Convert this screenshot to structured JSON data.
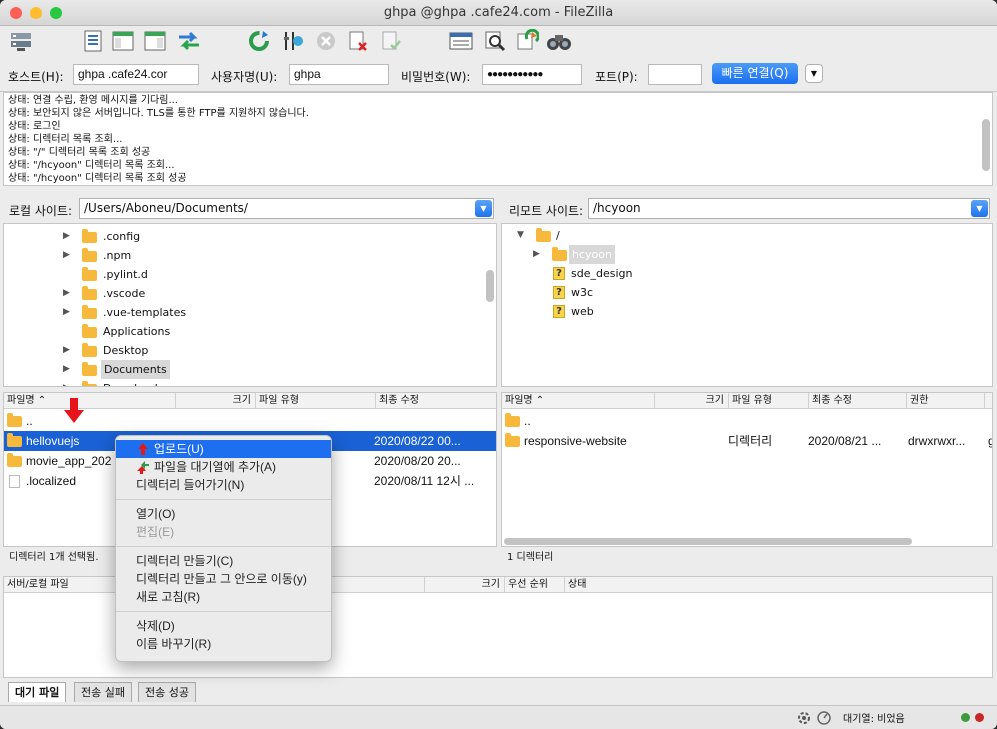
{
  "window": {
    "title": "ghpa        @ghpa        .cafe24.com - FileZilla"
  },
  "toolbar": {
    "icons": [
      "site-manager-icon",
      "message-log-icon",
      "local-tree-icon",
      "remote-tree-icon",
      "transfer-queue-icon",
      "refresh-icon",
      "process-queue-icon",
      "cancel-icon",
      "disconnect-icon",
      "reconnect-icon",
      "filter-icon",
      "compare-icon",
      "sync-browse-icon",
      "search-icon"
    ]
  },
  "quickconnect": {
    "host_label": "호스트(H):",
    "host_value": "ghpa      .cafe24.cor",
    "user_label": "사용자명(U):",
    "user_value": "ghpa",
    "pass_label": "비밀번호(W):",
    "pass_value": "●●●●●●●●●●●",
    "port_label": "포트(P):",
    "port_value": "",
    "connect_label": "빠른 연결(Q)",
    "dropdown_glyph": "▼"
  },
  "log": [
    "상태:  연결 수립, 환영 메시지를 기다림...",
    "상태:  보안되지 않은 서버입니다. TLS를 통한 FTP를 지원하지 않습니다.",
    "상태:  로그인",
    "상태:  디렉터리 목록 조회...",
    "상태:  \"/\" 디렉터리 목록 조회 성공",
    "상태:  \"/hcyoon\" 디렉터리 목록 조회...",
    "상태:  \"/hcyoon\" 디렉터리 목록 조회 성공"
  ],
  "local": {
    "site_label": "로컬 사이트:",
    "path": "/Users/Aboneu/Documents/",
    "tree": [
      {
        "name": ".config",
        "expander": "▶"
      },
      {
        "name": ".npm",
        "expander": "▶"
      },
      {
        "name": ".pylint.d",
        "expander": ""
      },
      {
        "name": ".vscode",
        "expander": "▶"
      },
      {
        "name": ".vue-templates",
        "expander": "▶"
      },
      {
        "name": "Applications",
        "expander": ""
      },
      {
        "name": "Desktop",
        "expander": "▶"
      },
      {
        "name": "Documents",
        "expander": "▶"
      },
      {
        "name": "Downloads",
        "expander": "▶"
      }
    ],
    "headers": {
      "name": "파일명",
      "size": "크기",
      "type": "파일 유형",
      "modified": "최종 수정"
    },
    "files": [
      {
        "name": "..",
        "modified": ""
      },
      {
        "name": "hellovuejs",
        "modified": "2020/08/22 00..."
      },
      {
        "name": "movie_app_202",
        "modified": "2020/08/20 20..."
      },
      {
        "name": ".localized",
        "modified": "2020/08/11 12시 ..."
      }
    ],
    "status": "디렉터리 1개 선택됨."
  },
  "remote": {
    "site_label": "리모트 사이트:",
    "path": "/hcyoon",
    "tree": [
      {
        "name": "/",
        "expander": "▼"
      },
      {
        "name": "hcyoon",
        "expander": "▶"
      },
      {
        "name": "sde_design",
        "expander": ""
      },
      {
        "name": "w3c",
        "expander": ""
      },
      {
        "name": "web",
        "expander": ""
      }
    ],
    "unknown_glyph": "?",
    "headers": {
      "name": "파일명",
      "size": "크기",
      "type": "파일 유형",
      "modified": "최종 수정",
      "perm": "권한",
      "extra": ""
    },
    "files": [
      {
        "name": "..",
        "type": "",
        "modified": "",
        "perm": "",
        "extra": ""
      },
      {
        "name": "responsive-website",
        "type": "디렉터리",
        "modified": "2020/08/21 ...",
        "perm": "drwxrwxr...",
        "extra": "g"
      }
    ],
    "status": "1 디렉터리"
  },
  "queue": {
    "headers": {
      "file": "서버/로컬 파일",
      "size": "크기",
      "priority": "우선 순위",
      "state": "상태"
    }
  },
  "tabs": [
    "대기 파일",
    "전송 실패",
    "전송 성공"
  ],
  "footer": {
    "queue_status": "대기열: 비었음"
  },
  "context_menu": {
    "items": [
      {
        "label": "업로드(U)",
        "state": "highlighted",
        "icon": "upload-arrow-icon"
      },
      {
        "label": "파일을 대기열에 추가(A)",
        "state": "normal",
        "icon": "add-queue-icon"
      },
      {
        "label": "디렉터리 들어가기(N)",
        "state": "normal"
      },
      {
        "label": "열기(O)",
        "state": "normal"
      },
      {
        "label": "편집(E)",
        "state": "disabled"
      },
      {
        "label": "디렉터리 만들기(C)",
        "state": "normal"
      },
      {
        "label": "디렉터리 만들고 그 안으로 이동(y)",
        "state": "normal"
      },
      {
        "label": "새로 고침(R)",
        "state": "normal"
      },
      {
        "label": "삭제(D)",
        "state": "normal"
      },
      {
        "label": "이름 바꾸기(R)",
        "state": "normal"
      }
    ]
  },
  "colors": {
    "selection": "#1a61d6",
    "accent": "#1e6ff0",
    "folder": "#f6b93b",
    "annotation_arrow": "#e8141b"
  }
}
